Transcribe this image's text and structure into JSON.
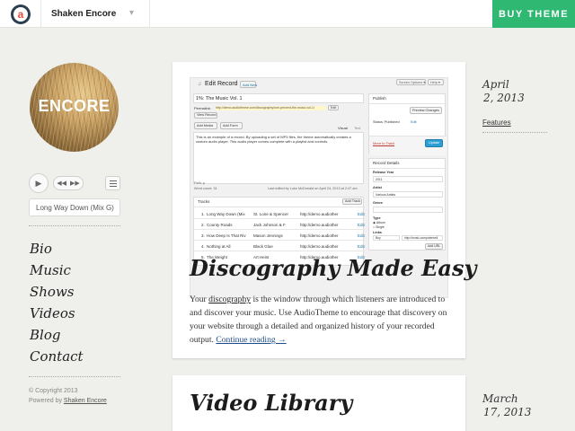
{
  "topbar": {
    "logo_letter": "a",
    "theme_name": "Shaken Encore",
    "theme_caret": "▾",
    "buy_label": "BUY THEME"
  },
  "sidebar": {
    "brand_text": "ENCORE",
    "player": {
      "play_icon": "▶",
      "prev_icon": "◀◀",
      "next_icon": "▶▶",
      "current_track": "Long Way Down (Mix G)"
    },
    "nav": [
      {
        "label": "Bio"
      },
      {
        "label": "Music"
      },
      {
        "label": "Shows"
      },
      {
        "label": "Videos"
      },
      {
        "label": "Blog"
      },
      {
        "label": "Contact"
      }
    ],
    "footer": {
      "copyright": "© Copyright 2013",
      "powered_prefix": "Powered by ",
      "powered_link": "Shaken Encore"
    }
  },
  "posts": [
    {
      "title": "Discography Made Easy",
      "excerpt_before": "Your ",
      "excerpt_link": "discography",
      "excerpt_after": " is the window through which listeners are introduced to and discover your music. Use AudioTheme to encourage that discovery on your website through a detailed and organized history of your recorded output. ",
      "continue_label": "Continue reading →",
      "date_month_day": "April",
      "date_day_year": "2, 2013",
      "category": "Features",
      "screenshot": {
        "heading": "Edit Record",
        "add_new": "Add New",
        "screen_options": "Screen Options ▾",
        "help": "Help ▾",
        "record_title": "1%: The Music Vol. 1",
        "permalink": "Permalink:",
        "permalink_url": "http://demo.audiotheme.com/discography/one-percent-the-music-vol-1/",
        "edit": "Edit",
        "view_record": "View Record",
        "add_media": "Add Media",
        "add_form": "Add Form",
        "visual": "Visual",
        "text_tab": "Text",
        "body_text": "This is an example of a record. By uploading a set of MP3 files, the theme automatically creates a custom audio player. This audio player comes complete with a playlist and controls.",
        "path": "Path: p",
        "word_count": "Word count: 31",
        "last_edited": "Last edited by Luke McDonald on April 24, 2013 at 2:47 am",
        "tracks_label": "Tracks",
        "add_track": "Add Track",
        "tracks": [
          {
            "num": "1.",
            "title": "Long Way Down (Mix",
            "artist": "St. Lone &amp; Spencer",
            "url": "http://demo.audiother",
            "edit": "Edit"
          },
          {
            "num": "2.",
            "title": "County Roads",
            "artist": "Jack Johnson &amp; F",
            "url": "http://demo.audiother",
            "edit": "Edit"
          },
          {
            "num": "3.",
            "title": "How Deep Is That Riv",
            "artist": "Mason Jennings",
            "url": "http://demo.audiother",
            "edit": "Edit"
          },
          {
            "num": "4.",
            "title": "Nothing at All",
            "artist": "Black Glue",
            "url": "http://demo.audiother",
            "edit": "Edit"
          },
          {
            "num": "5.",
            "title": "The Weight",
            "artist": "Art Heist",
            "url": "http://demo.audiother",
            "edit": "Edit"
          }
        ],
        "publish_title": "Publish",
        "preview_changes": "Preview Changes",
        "status": "Status: Published",
        "status_edit": "Edit",
        "move_trash": "Move to Trash",
        "update": "Update",
        "record_details": "Record Details",
        "release_year_label": "Release Year",
        "release_year": "2011",
        "artist_label": "Artist",
        "artist": "Various Artists",
        "genre_label": "Genre",
        "type_label": "Type",
        "type_album": "Album",
        "type_single": "Single",
        "links_label": "Links",
        "link_name": "Buy",
        "link_url": "http://music.computerwell",
        "add_url": "Add URL"
      }
    },
    {
      "title": "Video Library",
      "date_month_day": "March",
      "date_day_year": "17, 2013"
    }
  ]
}
